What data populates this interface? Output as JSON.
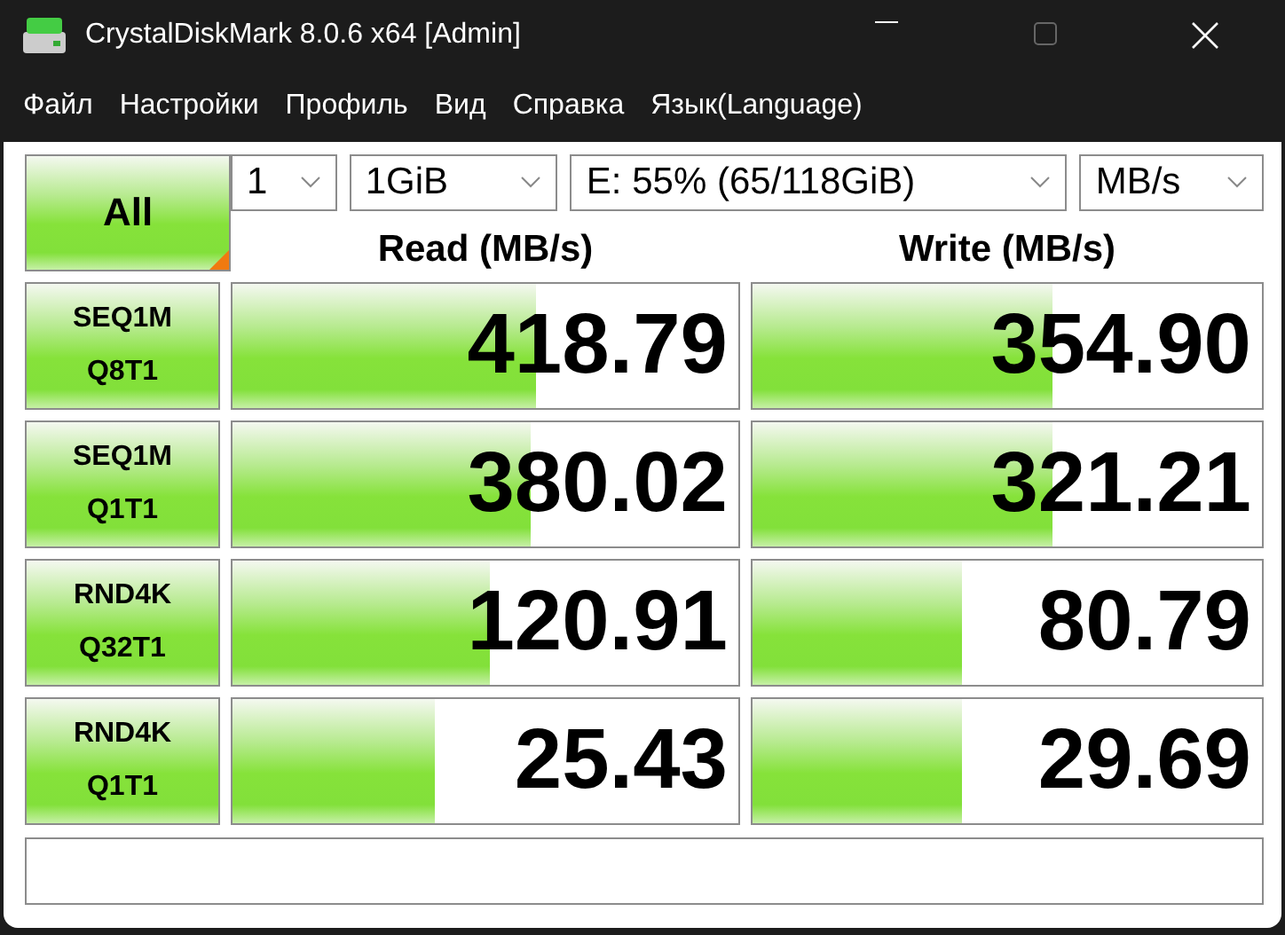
{
  "window": {
    "title": "CrystalDiskMark 8.0.6 x64 [Admin]"
  },
  "menu": [
    "Файл",
    "Настройки",
    "Профиль",
    "Вид",
    "Справка",
    "Язык(Language)"
  ],
  "all_button": {
    "label": "All"
  },
  "selectors": [
    {
      "value": "1"
    },
    {
      "value": "1GiB"
    },
    {
      "value": "E: 55% (65/118GiB)"
    },
    {
      "value": "MB/s"
    }
  ],
  "columns": [
    "Read (MB/s)",
    "Write (MB/s)"
  ],
  "rows": [
    {
      "test": [
        "SEQ1M",
        "Q8T1"
      ],
      "read": {
        "value": "418.79",
        "level": 0.6
      },
      "write": {
        "value": "354.90",
        "level": 0.59
      }
    },
    {
      "test": [
        "SEQ1M",
        "Q1T1"
      ],
      "read": {
        "value": "380.02",
        "level": 0.59
      },
      "write": {
        "value": "321.21",
        "level": 0.59
      }
    },
    {
      "test": [
        "RND4K",
        "Q32T1"
      ],
      "read": {
        "value": "120.91",
        "level": 0.51
      },
      "write": {
        "value": "80.79",
        "level": 0.41
      }
    },
    {
      "test": [
        "RND4K",
        "Q1T1"
      ],
      "read": {
        "value": "25.43",
        "level": 0.4
      },
      "write": {
        "value": "29.69",
        "level": 0.41
      }
    }
  ]
}
